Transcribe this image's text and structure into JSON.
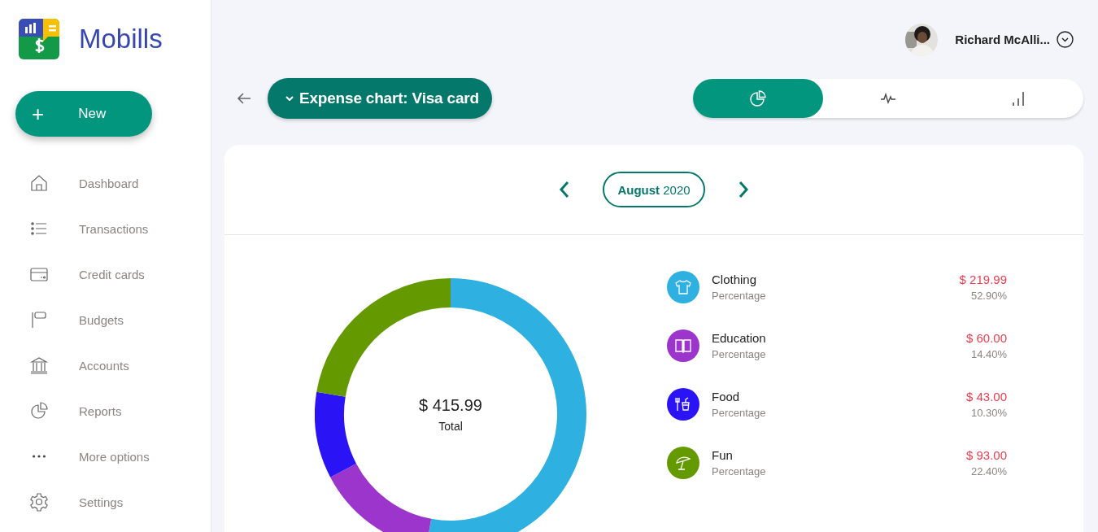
{
  "brand": {
    "name": "Mobills"
  },
  "new_button": {
    "icon": "+",
    "label": "New"
  },
  "sidebar": {
    "items": [
      {
        "kind": "home",
        "label": "Dashboard"
      },
      {
        "kind": "list",
        "label": "Transactions"
      },
      {
        "kind": "card",
        "label": "Credit cards"
      },
      {
        "kind": "flag",
        "label": "Budgets"
      },
      {
        "kind": "bank",
        "label": "Accounts"
      },
      {
        "kind": "pie",
        "label": "Reports"
      },
      {
        "kind": "dots",
        "label": "More options"
      },
      {
        "kind": "gear",
        "label": "Settings"
      }
    ]
  },
  "user": {
    "name": "Richard McAlli..."
  },
  "toolbar": {
    "title_prefix": "Expense chart:",
    "title": "Visa card",
    "views": [
      {
        "kind": "pie",
        "selected": true
      },
      {
        "kind": "line",
        "selected": false
      },
      {
        "kind": "bars",
        "selected": false
      }
    ]
  },
  "period": {
    "month": "August",
    "year": "2020"
  },
  "chart": {
    "total": "$ 415.99",
    "total_label": "Total",
    "chart_data": {
      "type": "donut",
      "values": [
        52.9,
        14.4,
        10.3,
        22.4
      ]
    }
  },
  "categories": [
    {
      "kind": "clothing",
      "name": "Clothing",
      "caption": "Percentage",
      "amount": "$ 219.99",
      "percent": "52.90%",
      "color": "#2eb0e0"
    },
    {
      "kind": "education",
      "name": "Education",
      "caption": "Percentage",
      "amount": "$ 60.00",
      "percent": "14.40%",
      "color": "#9b35cc"
    },
    {
      "kind": "food",
      "name": "Food",
      "caption": "Percentage",
      "amount": "$ 43.00",
      "percent": "10.30%",
      "color": "#2a14f5"
    },
    {
      "kind": "fun",
      "name": "Fun",
      "caption": "Percentage",
      "amount": "$ 93.00",
      "percent": "22.40%",
      "color": "#649a00"
    }
  ]
}
